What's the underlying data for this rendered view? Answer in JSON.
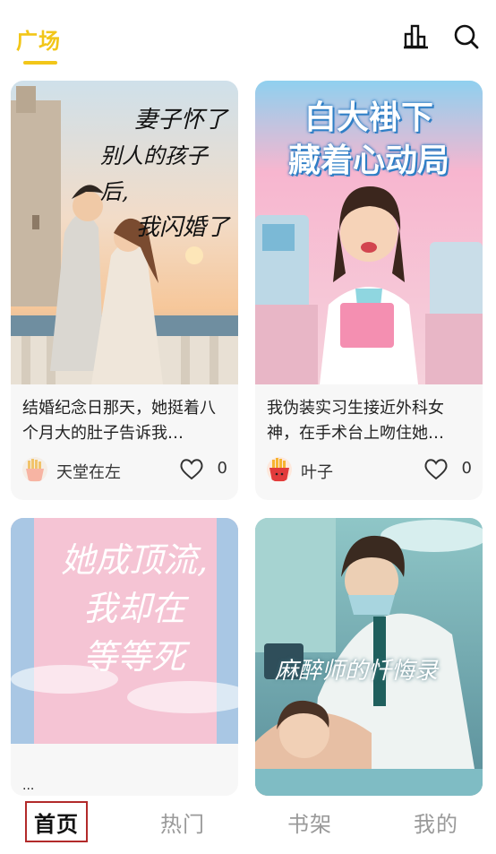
{
  "header": {
    "title": "广场",
    "icons": [
      "stats-icon",
      "search-icon"
    ]
  },
  "cards": [
    {
      "cover_title_lines": [
        "妻子怀了",
        "别人的孩子后,",
        "我闪婚了"
      ],
      "description": "结婚纪念日那天，她挺着八个月大的肚子告诉我…",
      "author": "天堂在左",
      "likes": "0",
      "avatar": "fries-avatar-pale"
    },
    {
      "cover_title_lines": [
        "白大褂下",
        "藏着心动局"
      ],
      "description": "我伪装实习生接近外科女神，在手术台上吻住她…",
      "author": "叶子",
      "likes": "0",
      "avatar": "fries-avatar-red"
    },
    {
      "cover_title_lines": [
        "她成顶流,",
        "我却在",
        "等等死"
      ],
      "description": "...",
      "author": "",
      "likes": ""
    },
    {
      "cover_title_lines": [
        "麻醉师的忏悔录"
      ],
      "description": "",
      "author": "",
      "likes": ""
    }
  ],
  "nav": {
    "items": [
      "首页",
      "热门",
      "书架",
      "我的"
    ],
    "active": "首页"
  },
  "colors": {
    "accent": "#f2c619",
    "active_outline": "#b22a2a",
    "inactive_nav": "#9a9a9a",
    "card_bg": "#f7f7f7"
  }
}
